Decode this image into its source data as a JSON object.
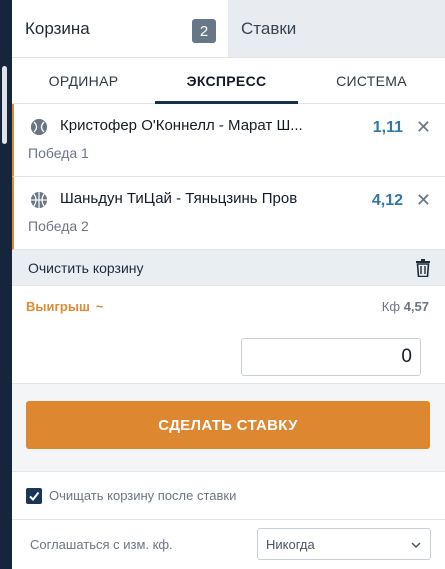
{
  "top_tabs": {
    "basket_label": "Корзина",
    "basket_count": "2",
    "stakes_label": "Ставки"
  },
  "mode_tabs": [
    {
      "label": "ОРДИНАР",
      "active": false
    },
    {
      "label": "ЭКСПРЕСС",
      "active": true
    },
    {
      "label": "СИСТЕМА",
      "active": false
    }
  ],
  "bets": [
    {
      "title": "Кристофер О'Коннелл - Марат Ш...",
      "outcome": "Победа 1",
      "coef": "1,11",
      "sport_icon": "tennis-ball-icon"
    },
    {
      "title": "Шаньдун ТиЦай - Тяньцзинь Пров",
      "outcome": "Победа 2",
      "coef": "4,12",
      "sport_icon": "basketball-icon"
    }
  ],
  "clear": {
    "label": "Очистить корзину",
    "icon": "trash-icon"
  },
  "win": {
    "label": "Выигрыш",
    "tilde": "~",
    "kf_label": "Кф",
    "kf_value": "4,57"
  },
  "amount": {
    "value": "0"
  },
  "place_bet": {
    "label": "СДЕЛАТЬ СТАВКУ"
  },
  "clear_after": {
    "label": "Очищать корзину после ставки",
    "checked": true
  },
  "agree": {
    "label": "Соглашаться с изм. кф.",
    "selected": "Никогда"
  },
  "colors": {
    "accent": "#dd8731",
    "coef": "#2f78a8",
    "dark": "#14253c"
  }
}
